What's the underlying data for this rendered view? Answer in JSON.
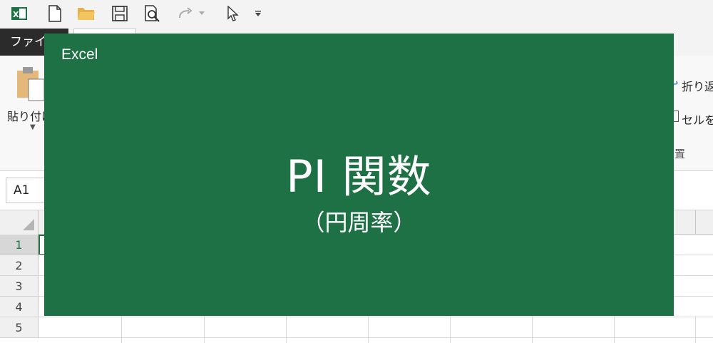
{
  "qat": {
    "icons": [
      "excel-logo-icon",
      "new-document-icon",
      "open-folder-icon",
      "save-icon",
      "print-preview-icon",
      "redo-icon",
      "pointer-icon",
      "customize-dropdown-icon"
    ]
  },
  "tabs": {
    "file": "ファイル"
  },
  "ribbon": {
    "paste_label": "貼り付け",
    "wrap_text": "折り返",
    "merge_cells": "セルを",
    "alignment_group": "置"
  },
  "formula_bar": {
    "name_box": "A1"
  },
  "grid": {
    "rows": [
      "1",
      "2",
      "3",
      "4",
      "5"
    ],
    "active_row": "1"
  },
  "splash": {
    "app_name": "Excel",
    "title": "PI 関数",
    "subtitle": "（円周率）"
  },
  "colors": {
    "excel_green": "#1e7145",
    "file_tab": "#2b2b2b"
  }
}
